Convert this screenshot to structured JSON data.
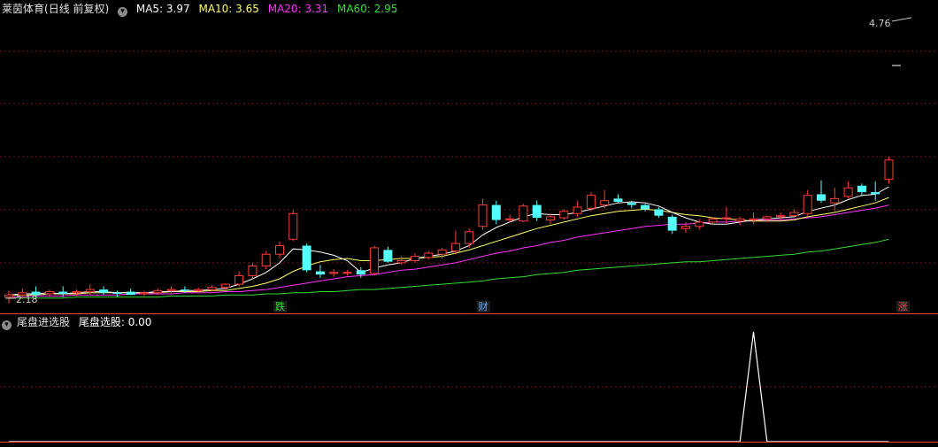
{
  "panel_main": {
    "title": "莱茵体育",
    "period": "(日线 前复权)",
    "ma5": "MA5: 3.97",
    "ma10": "MA10: 3.65",
    "ma20": "MA20: 3.31",
    "ma60": "MA60: 2.95",
    "high_label": "4.76",
    "low_label": "2.18",
    "badges": [
      {
        "text": "跌",
        "color": "#33dd33"
      },
      {
        "text": "财",
        "color": "#66aaff"
      },
      {
        "text": "涨",
        "color": "#ff4444"
      }
    ]
  },
  "panel_sub": {
    "title": "尾盘进选股",
    "value_label": "尾盘选股: 0.00"
  },
  "colors": {
    "up": "#ff3c3c",
    "down": "#54ffff",
    "ma5": "#ffffff",
    "ma10": "#ffff66",
    "ma20": "#ff33ff",
    "ma60": "#33dd33",
    "grid": "#7a1515",
    "axis": "#ff3c3c",
    "signal": "#ffffff"
  },
  "chart_data": {
    "type": "candlestick",
    "ylim": [
      2.18,
      4.76
    ],
    "candles": [
      [
        2.2,
        2.26,
        2.14,
        2.22
      ],
      [
        2.22,
        2.28,
        2.18,
        2.24
      ],
      [
        2.25,
        2.3,
        2.19,
        2.22
      ],
      [
        2.23,
        2.27,
        2.2,
        2.25
      ],
      [
        2.25,
        2.3,
        2.2,
        2.23
      ],
      [
        2.24,
        2.27,
        2.21,
        2.25
      ],
      [
        2.25,
        2.32,
        2.22,
        2.27
      ],
      [
        2.27,
        2.3,
        2.22,
        2.24
      ],
      [
        2.24,
        2.26,
        2.2,
        2.23
      ],
      [
        2.25,
        2.28,
        2.22,
        2.22
      ],
      [
        2.23,
        2.26,
        2.21,
        2.24
      ],
      [
        2.24,
        2.28,
        2.22,
        2.26
      ],
      [
        2.26,
        2.3,
        2.23,
        2.27
      ],
      [
        2.27,
        2.3,
        2.24,
        2.26
      ],
      [
        2.26,
        2.29,
        2.24,
        2.27
      ],
      [
        2.27,
        2.31,
        2.25,
        2.29
      ],
      [
        2.29,
        2.33,
        2.27,
        2.32
      ],
      [
        2.32,
        2.44,
        2.3,
        2.4
      ],
      [
        2.4,
        2.52,
        2.36,
        2.49
      ],
      [
        2.49,
        2.63,
        2.46,
        2.6
      ],
      [
        2.6,
        2.72,
        2.56,
        2.68
      ],
      [
        2.74,
        3.01,
        2.72,
        2.98
      ],
      [
        2.68,
        2.7,
        2.43,
        2.45
      ],
      [
        2.44,
        2.5,
        2.38,
        2.41
      ],
      [
        2.42,
        2.46,
        2.39,
        2.43
      ],
      [
        2.43,
        2.45,
        2.4,
        2.43
      ],
      [
        2.45,
        2.48,
        2.38,
        2.41
      ],
      [
        2.42,
        2.68,
        2.4,
        2.66
      ],
      [
        2.64,
        2.67,
        2.52,
        2.53
      ],
      [
        2.52,
        2.58,
        2.5,
        2.54
      ],
      [
        2.54,
        2.61,
        2.52,
        2.58
      ],
      [
        2.57,
        2.63,
        2.55,
        2.61
      ],
      [
        2.6,
        2.66,
        2.56,
        2.64
      ],
      [
        2.63,
        2.82,
        2.6,
        2.7
      ],
      [
        2.7,
        2.84,
        2.66,
        2.81
      ],
      [
        2.86,
        3.12,
        2.83,
        3.06
      ],
      [
        3.06,
        3.1,
        2.88,
        2.92
      ],
      [
        2.93,
        2.97,
        2.9,
        2.93
      ],
      [
        2.91,
        3.07,
        2.9,
        3.05
      ],
      [
        3.06,
        3.1,
        2.91,
        2.94
      ],
      [
        2.92,
        2.98,
        2.88,
        2.95
      ],
      [
        2.94,
        3.02,
        2.92,
        3.0
      ],
      [
        2.98,
        3.1,
        2.95,
        3.04
      ],
      [
        3.03,
        3.18,
        3.0,
        3.15
      ],
      [
        3.06,
        3.2,
        3.03,
        3.1
      ],
      [
        3.12,
        3.16,
        3.08,
        3.09
      ],
      [
        3.08,
        3.1,
        3.03,
        3.06
      ],
      [
        3.06,
        3.07,
        3.0,
        3.02
      ],
      [
        3.02,
        3.04,
        2.94,
        2.96
      ],
      [
        2.95,
        2.97,
        2.79,
        2.82
      ],
      [
        2.84,
        2.9,
        2.8,
        2.86
      ],
      [
        2.86,
        2.93,
        2.83,
        2.9
      ],
      [
        2.9,
        2.94,
        2.88,
        2.93
      ],
      [
        2.94,
        3.04,
        2.88,
        2.94
      ],
      [
        2.91,
        2.95,
        2.87,
        2.93
      ],
      [
        2.92,
        2.99,
        2.88,
        2.93
      ],
      [
        2.93,
        2.96,
        2.9,
        2.95
      ],
      [
        2.95,
        2.99,
        2.92,
        2.96
      ],
      [
        2.96,
        3.02,
        2.94,
        2.99
      ],
      [
        2.98,
        3.2,
        2.96,
        3.15
      ],
      [
        3.16,
        3.29,
        3.08,
        3.1
      ],
      [
        3.08,
        3.22,
        3.0,
        3.12
      ],
      [
        3.14,
        3.28,
        3.12,
        3.22
      ],
      [
        3.24,
        3.26,
        3.14,
        3.18
      ],
      [
        3.18,
        3.28,
        3.1,
        3.16
      ],
      [
        3.3,
        3.51,
        3.26,
        3.48
      ]
    ],
    "ma5": [
      2.22,
      2.23,
      2.23,
      2.24,
      2.23,
      2.24,
      2.25,
      2.25,
      2.24,
      2.24,
      2.24,
      2.25,
      2.25,
      2.26,
      2.26,
      2.27,
      2.28,
      2.32,
      2.37,
      2.43,
      2.52,
      2.65,
      2.64,
      2.62,
      2.59,
      2.54,
      2.43,
      2.47,
      2.5,
      2.52,
      2.56,
      2.58,
      2.6,
      2.63,
      2.68,
      2.78,
      2.85,
      2.9,
      2.95,
      2.98,
      2.97,
      2.97,
      2.99,
      3.02,
      3.05,
      3.08,
      3.09,
      3.08,
      3.05,
      2.99,
      2.94,
      2.9,
      2.88,
      2.88,
      2.9,
      2.92,
      2.93,
      2.94,
      2.95,
      3.0,
      3.03,
      3.06,
      3.11,
      3.15,
      3.16,
      3.23
    ],
    "ma10": [
      2.22,
      2.22,
      2.22,
      2.23,
      2.23,
      2.23,
      2.24,
      2.24,
      2.24,
      2.24,
      2.24,
      2.24,
      2.25,
      2.25,
      2.25,
      2.26,
      2.26,
      2.28,
      2.3,
      2.33,
      2.37,
      2.44,
      2.49,
      2.53,
      2.55,
      2.56,
      2.54,
      2.54,
      2.55,
      2.56,
      2.56,
      2.57,
      2.58,
      2.61,
      2.64,
      2.68,
      2.72,
      2.76,
      2.8,
      2.84,
      2.87,
      2.9,
      2.93,
      2.96,
      2.98,
      3.0,
      3.01,
      3.02,
      3.01,
      2.99,
      2.97,
      2.96,
      2.94,
      2.93,
      2.92,
      2.91,
      2.91,
      2.91,
      2.92,
      2.95,
      2.97,
      2.99,
      3.02,
      3.05,
      3.08,
      3.13
    ],
    "ma20": [
      2.2,
      2.2,
      2.21,
      2.21,
      2.21,
      2.22,
      2.22,
      2.22,
      2.22,
      2.23,
      2.23,
      2.23,
      2.23,
      2.24,
      2.24,
      2.24,
      2.25,
      2.25,
      2.26,
      2.27,
      2.29,
      2.31,
      2.33,
      2.35,
      2.37,
      2.39,
      2.4,
      2.41,
      2.43,
      2.45,
      2.46,
      2.48,
      2.5,
      2.52,
      2.55,
      2.58,
      2.61,
      2.63,
      2.66,
      2.68,
      2.71,
      2.73,
      2.76,
      2.78,
      2.8,
      2.82,
      2.84,
      2.86,
      2.87,
      2.88,
      2.88,
      2.89,
      2.9,
      2.9,
      2.91,
      2.91,
      2.92,
      2.92,
      2.93,
      2.94,
      2.95,
      2.97,
      2.99,
      3.01,
      3.03,
      3.06
    ],
    "ma60": [
      2.19,
      2.19,
      2.19,
      2.19,
      2.19,
      2.2,
      2.2,
      2.2,
      2.2,
      2.2,
      2.2,
      2.2,
      2.21,
      2.21,
      2.21,
      2.21,
      2.22,
      2.22,
      2.22,
      2.23,
      2.23,
      2.24,
      2.24,
      2.25,
      2.25,
      2.26,
      2.27,
      2.27,
      2.28,
      2.29,
      2.3,
      2.31,
      2.32,
      2.33,
      2.34,
      2.35,
      2.37,
      2.38,
      2.39,
      2.41,
      2.42,
      2.43,
      2.45,
      2.46,
      2.47,
      2.48,
      2.49,
      2.5,
      2.51,
      2.52,
      2.53,
      2.53,
      2.54,
      2.55,
      2.56,
      2.57,
      2.58,
      2.59,
      2.6,
      2.62,
      2.63,
      2.65,
      2.67,
      2.69,
      2.71,
      2.74
    ],
    "badge_indices": [
      20,
      35,
      66
    ],
    "signal": {
      "values_all_zero_except": 55,
      "peak_value": 1,
      "ylim": [
        0,
        1
      ]
    }
  }
}
